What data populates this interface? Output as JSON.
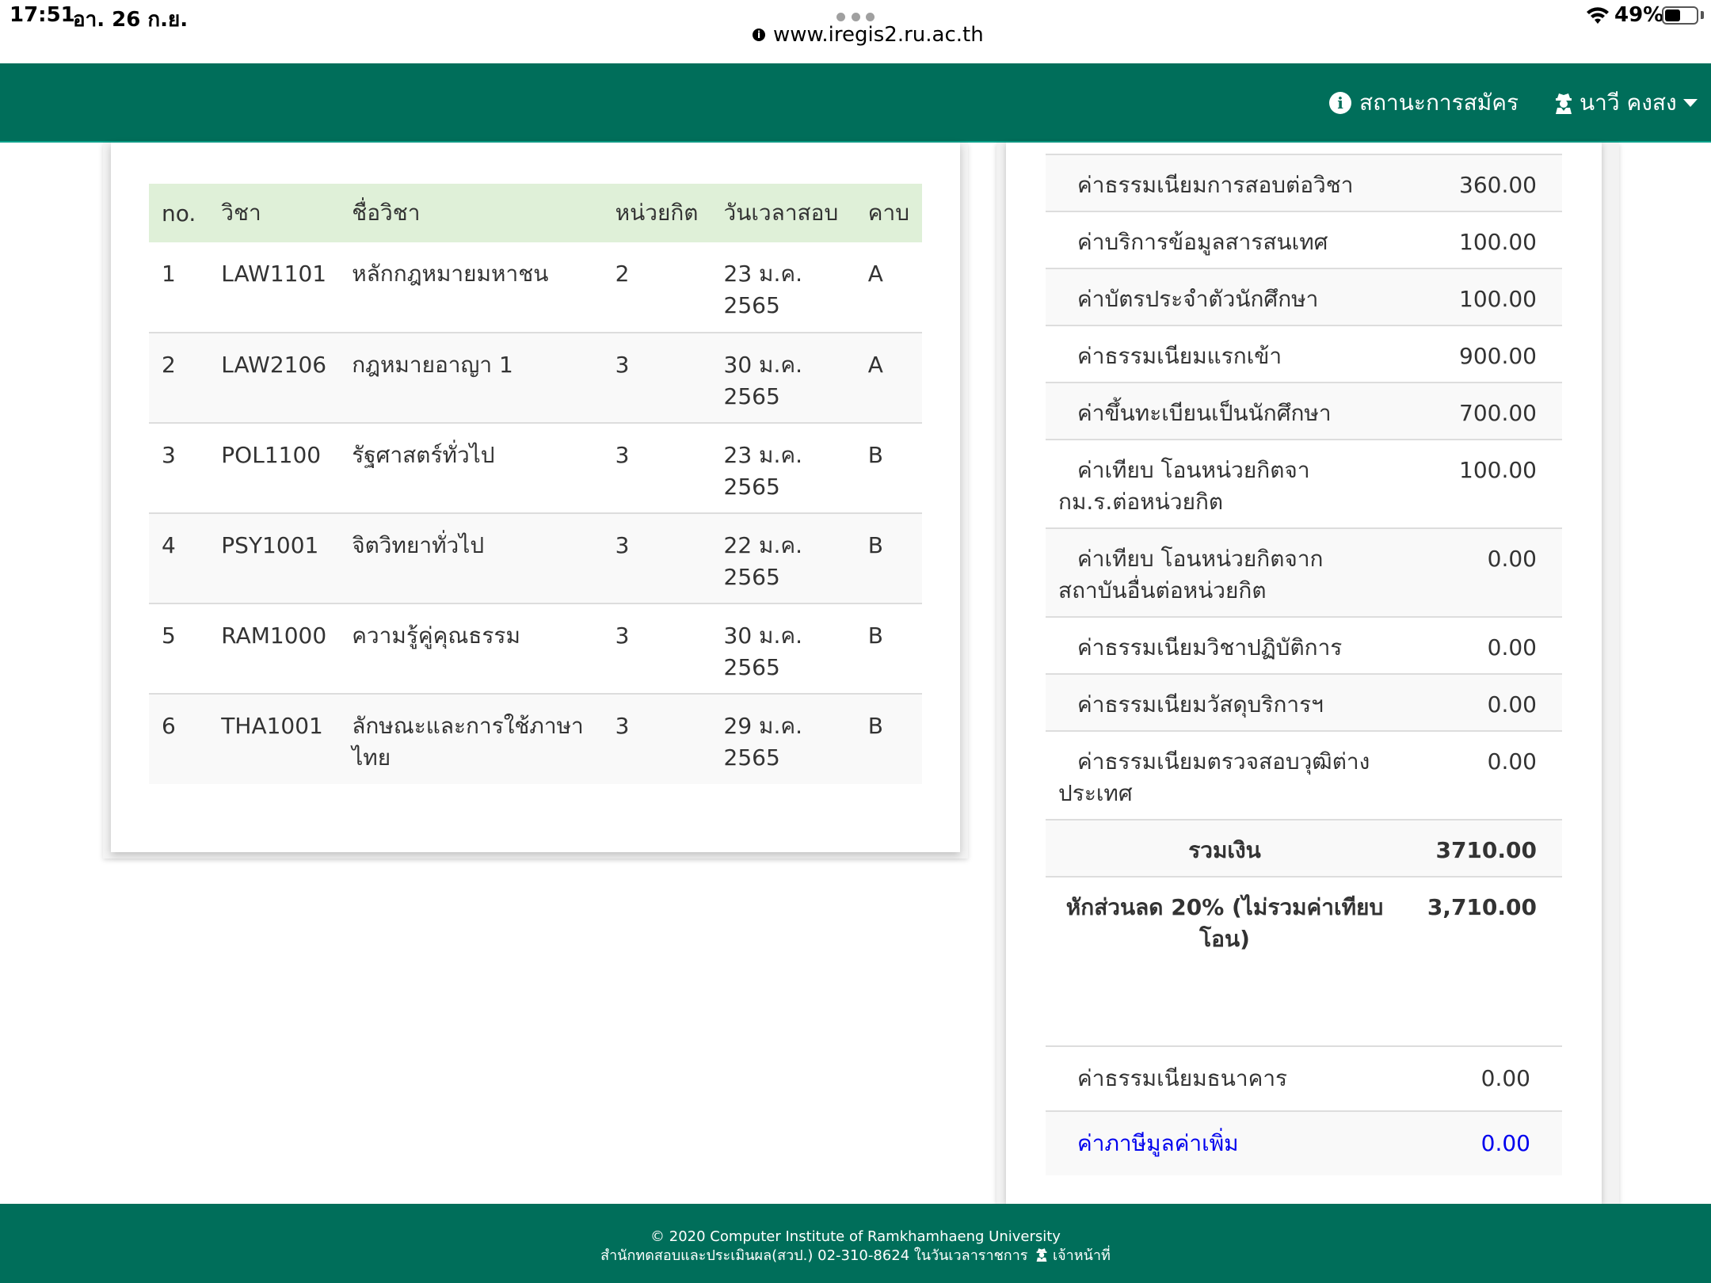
{
  "statusbar": {
    "time": "17:51",
    "date": "อา. 26 ก.ย.",
    "url": "www.iregis2.ru.ac.th",
    "battery_percent": "49%",
    "battery_level": 0.49
  },
  "navbar": {
    "status_label": "สถานะการสมัคร",
    "user_label": "นาวี คงสง"
  },
  "courses": {
    "headers": [
      "no.",
      "วิชา",
      "ชื่อวิชา",
      "หน่วยกิต",
      "วันเวลาสอบ",
      "คาบ"
    ],
    "rows": [
      {
        "no": "1",
        "code": "LAW1101",
        "name": "หลักกฎหมายมหาชน",
        "credits": "2",
        "exam": "23 ม.ค. 2565",
        "period": "A"
      },
      {
        "no": "2",
        "code": "LAW2106",
        "name": "กฎหมายอาญา 1",
        "credits": "3",
        "exam": "30 ม.ค. 2565",
        "period": "A"
      },
      {
        "no": "3",
        "code": "POL1100",
        "name": "รัฐศาสตร์ทั่วไป",
        "credits": "3",
        "exam": "23 ม.ค. 2565",
        "period": "B"
      },
      {
        "no": "4",
        "code": "PSY1001",
        "name": "จิตวิทยาทั่วไป",
        "credits": "3",
        "exam": "22 ม.ค. 2565",
        "period": "B"
      },
      {
        "no": "5",
        "code": "RAM1000",
        "name": "ความรู้คู่คุณธรรม",
        "credits": "3",
        "exam": "30 ม.ค. 2565",
        "period": "B"
      },
      {
        "no": "6",
        "code": "THA1001",
        "name": "ลักษณะและการใช้ภาษาไทย",
        "credits": "3",
        "exam": "29 ม.ค. 2565",
        "period": "B"
      }
    ]
  },
  "fees": {
    "items": [
      {
        "label": "ค่าธรรมเนียมการสอบต่อวิชา",
        "amount": "360.00"
      },
      {
        "label": "ค่าบริการข้อมูลสารสนเทศ",
        "amount": "100.00"
      },
      {
        "label": "ค่าบัตรประจำตัวนักศึกษา",
        "amount": "100.00"
      },
      {
        "label": "ค่าธรรมเนียมแรกเข้า",
        "amount": "900.00"
      },
      {
        "label": "ค่าขึ้นทะเบียนเป็นนักศึกษา",
        "amount": "700.00"
      },
      {
        "label": "ค่าเทียบ โอนหน่วยกิตจากม.ร.ต่อหน่วยกิต",
        "amount": "100.00"
      },
      {
        "label": "ค่าเทียบ โอนหน่วยกิตจากสถาบันอื่นต่อหน่วยกิต",
        "amount": "0.00"
      },
      {
        "label": "ค่าธรรมเนียมวิชาปฏิบัติการ",
        "amount": "0.00"
      },
      {
        "label": "ค่าธรรมเนียมวัสดุบริการฯ",
        "amount": "0.00"
      },
      {
        "label": "ค่าธรรมเนียมตรวจสอบวุฒิต่างประเทศ",
        "amount": "0.00"
      }
    ],
    "total_label": "รวมเงิน",
    "total_amount": "3710.00",
    "discount_label": "หักส่วนลด 20% (ไม่รวมค่าเทียบโอน)",
    "discount_amount": "3,710.00",
    "bank_fee_label": "ค่าธรรมเนียมธนาคาร",
    "bank_fee_amount": "0.00",
    "vat_label": "ค่าภาษีมูลค่าเพิ่ม",
    "vat_amount": "0.00"
  },
  "footer": {
    "line1": "© 2020 Computer Institute of Ramkhamhaeng University",
    "line2": "สำนักทดสอบและประเมินผล(สวป.) 02-310-8624 ในวันเวลาราชการ",
    "line2_suffix": "เจ้าหน้าที่"
  },
  "icons": {
    "info": "info-circle-icon",
    "user": "user-secret-icon",
    "wifi": "wifi-icon",
    "battery": "battery-icon"
  },
  "colors": {
    "brand_green": "#006e5a",
    "table_header_green": "#dff0d8",
    "link_blue": "#0000ee"
  }
}
